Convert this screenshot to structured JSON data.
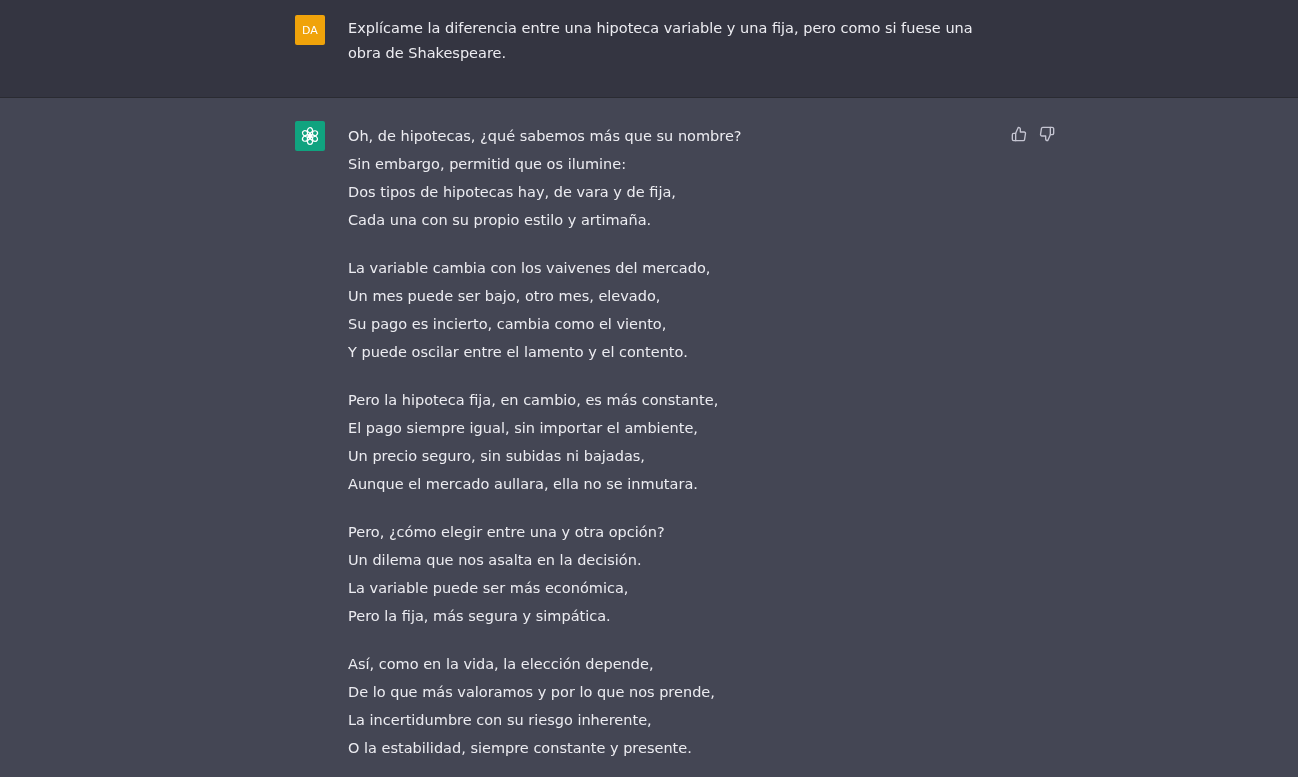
{
  "user_message": {
    "avatar": "DA",
    "text": "Explícame la diferencia entre una hipoteca variable y una fija, pero como si fuese una obra de Shakespeare."
  },
  "assistant_message": {
    "stanzas": [
      [
        "Oh, de hipotecas, ¿qué sabemos más que su nombre?",
        "Sin embargo, permitid que os ilumine:",
        "Dos tipos de hipotecas hay, de vara y de fija,",
        "Cada una con su propio estilo y artimaña."
      ],
      [
        "La variable cambia con los vaivenes del mercado,",
        "Un mes puede ser bajo, otro mes, elevado,",
        "Su pago es incierto, cambia como el viento,",
        "Y puede oscilar entre el lamento y el contento."
      ],
      [
        "Pero la hipoteca fija, en cambio, es más constante,",
        "El pago siempre igual, sin importar el ambiente,",
        "Un precio seguro, sin subidas ni bajadas,",
        "Aunque el mercado aullara, ella no se inmutara."
      ],
      [
        "Pero, ¿cómo elegir entre una y otra opción?",
        "Un dilema que nos asalta en la decisión.",
        "La variable puede ser más económica,",
        "Pero la fija, más segura y simpática."
      ],
      [
        "Así, como en la vida, la elección depende,",
        "De lo que más valoramos y por lo que nos prende,",
        "La incertidumbre con su riesgo inherente,",
        "O la estabilidad, siempre constante y presente."
      ]
    ]
  }
}
